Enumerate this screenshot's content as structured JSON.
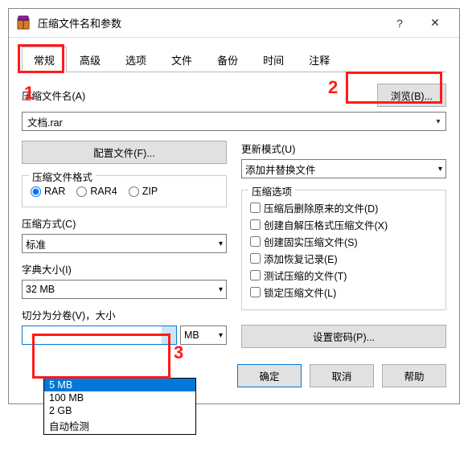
{
  "window": {
    "title": "压缩文件名和参数",
    "help_icon": "?",
    "close_icon": "✕"
  },
  "tabs": [
    "常规",
    "高级",
    "选项",
    "文件",
    "备份",
    "时间",
    "注释"
  ],
  "archive_name_label": "压缩文件名(A)",
  "browse_label": "浏览(B)...",
  "archive_name_value": "文档.rar",
  "profiles_label": "配置文件(F)...",
  "update_mode_label": "更新模式(U)",
  "update_mode_value": "添加并替换文件",
  "format_group": "压缩文件格式",
  "formats": {
    "rar": "RAR",
    "rar4": "RAR4",
    "zip": "ZIP"
  },
  "method_label": "压缩方式(C)",
  "method_value": "标准",
  "dict_label": "字典大小(I)",
  "dict_value": "32 MB",
  "split_label": "切分为分卷(V)，大小",
  "split_value": "",
  "split_unit": "MB",
  "split_options": [
    "5 MB",
    "100 MB",
    "2 GB",
    "自动检测"
  ],
  "options_group": "压缩选项",
  "options": [
    "压缩后删除原来的文件(D)",
    "创建自解压格式压缩文件(X)",
    "创建固实压缩文件(S)",
    "添加恢复记录(E)",
    "测试压缩的文件(T)",
    "锁定压缩文件(L)"
  ],
  "password_label": "设置密码(P)...",
  "footer": {
    "ok": "确定",
    "cancel": "取消",
    "help": "帮助"
  },
  "annotations": {
    "n1": "1",
    "n2": "2",
    "n3": "3"
  }
}
